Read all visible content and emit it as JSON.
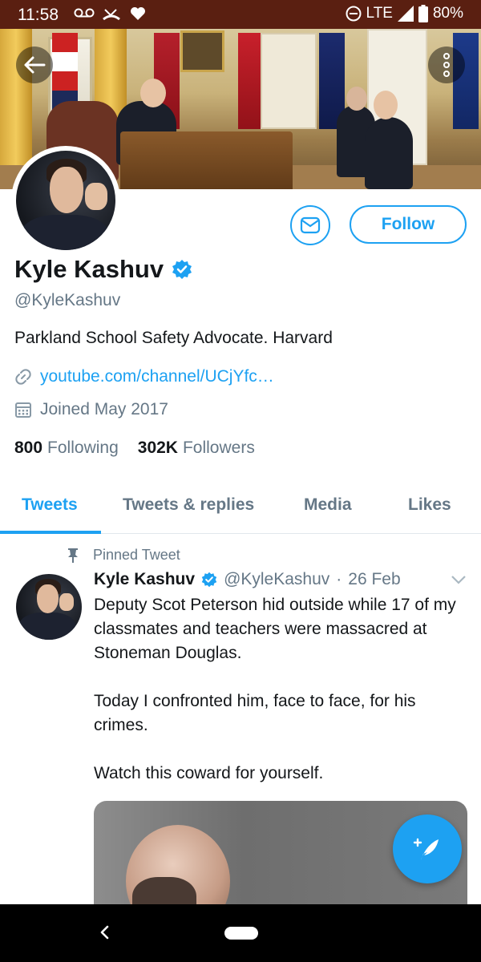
{
  "status_bar": {
    "time": "11:58",
    "network": "LTE",
    "battery": "80%",
    "icons": [
      "voicemail-icon",
      "missed-call-icon",
      "heart-icon",
      "do-not-disturb-icon",
      "signal-icon",
      "battery-icon"
    ]
  },
  "profile": {
    "display_name": "Kyle Kashuv",
    "handle": "@KyleKashuv",
    "bio": "Parkland School Safety Advocate. Harvard",
    "link": "youtube.com/channel/UCjYfc…",
    "joined": "Joined May 2017",
    "following_count": "800",
    "following_label": "Following",
    "followers_count": "302K",
    "followers_label": "Followers",
    "follow_button": "Follow",
    "verified": true
  },
  "tabs": [
    {
      "label": "Tweets",
      "active": true
    },
    {
      "label": "Tweets & replies",
      "active": false
    },
    {
      "label": "Media",
      "active": false
    },
    {
      "label": "Likes",
      "active": false
    }
  ],
  "pinned_tweet": {
    "pinned_label": "Pinned Tweet",
    "author_name": "Kyle Kashuv",
    "author_handle": "@KyleKashuv",
    "separator": "·",
    "date": "26 Feb",
    "text": "Deputy Scot Peterson hid outside while 17 of my classmates and teachers were massacred at Stoneman Douglas.\n\nToday I confronted him, face to face, for his crimes.\n\nWatch this coward for yourself."
  },
  "colors": {
    "accent": "#1da1f2",
    "secondary_text": "#657786",
    "primary_text": "#14171a",
    "status_bar": "#5a1f11"
  }
}
